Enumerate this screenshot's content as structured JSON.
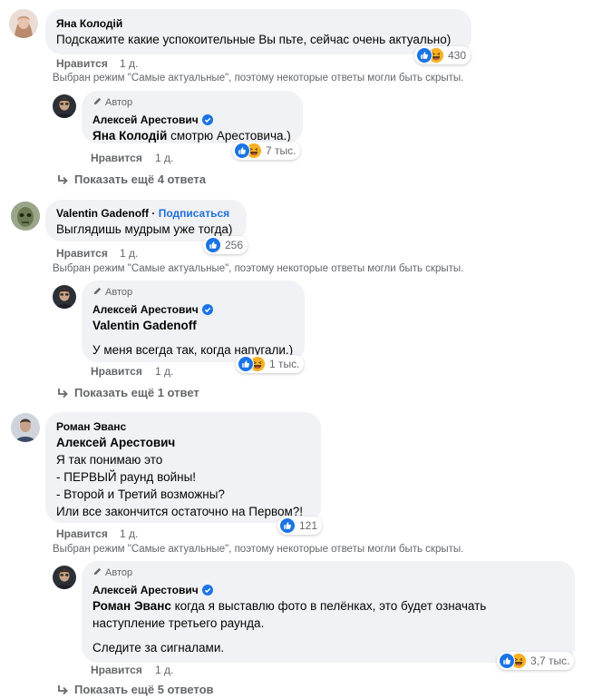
{
  "ui": {
    "like": "Нравится",
    "time": "1 д.",
    "author": "Автор",
    "subscribe": "Подписаться",
    "mode_note": "Выбран режим \"Самые актуальные\", поэтому некоторые ответы могли быть скрыты."
  },
  "c1": {
    "name": "Яна Колодій",
    "text": "Подскажите какие успокоительные Вы пьте, сейчас очень актуально)",
    "reactions": "430",
    "reply": {
      "name": "Алексей Арестович",
      "mention": "Яна Колодій",
      "text": " смотрю Арестовича.)",
      "reactions": "7 тыс."
    },
    "more": "Показать ещё 4 ответа"
  },
  "c2": {
    "name": "Valentin Gadenoff",
    "text": "Выглядишь мудрым уже тогда)",
    "reactions": "256",
    "reply": {
      "name": "Алексей Арестович",
      "mention": "Valentin Gadenoff",
      "text": "У меня всегда так, когда напугали.)",
      "reactions": "1 тыс."
    },
    "more": "Показать ещё 1 ответ"
  },
  "c3": {
    "name": "Роман Эванс",
    "mention": "Алексей Арестович",
    "lines": [
      "Я так понимаю это",
      "- ПЕРВЫЙ раунд войны!",
      "- Второй и Третий возможны?",
      "Или все закончится остаточно на Первом?!"
    ],
    "reactions": "121",
    "reply": {
      "name": "Алексей Арестович",
      "mention": "Роман Эванс",
      "line1": " когда я выставлю фото в пелёнках, это будет означать",
      "line2": "наступление третьего раунда.",
      "line3": "Следите за сигналами.",
      "reactions": "3,7 тыс."
    },
    "more": "Показать ещё 5 ответов"
  },
  "colors": {
    "bubble": "#f0f2f5",
    "link": "#216fdb",
    "like": "#1b74e4",
    "haha": "#f7b125",
    "muted": "#65676b"
  }
}
